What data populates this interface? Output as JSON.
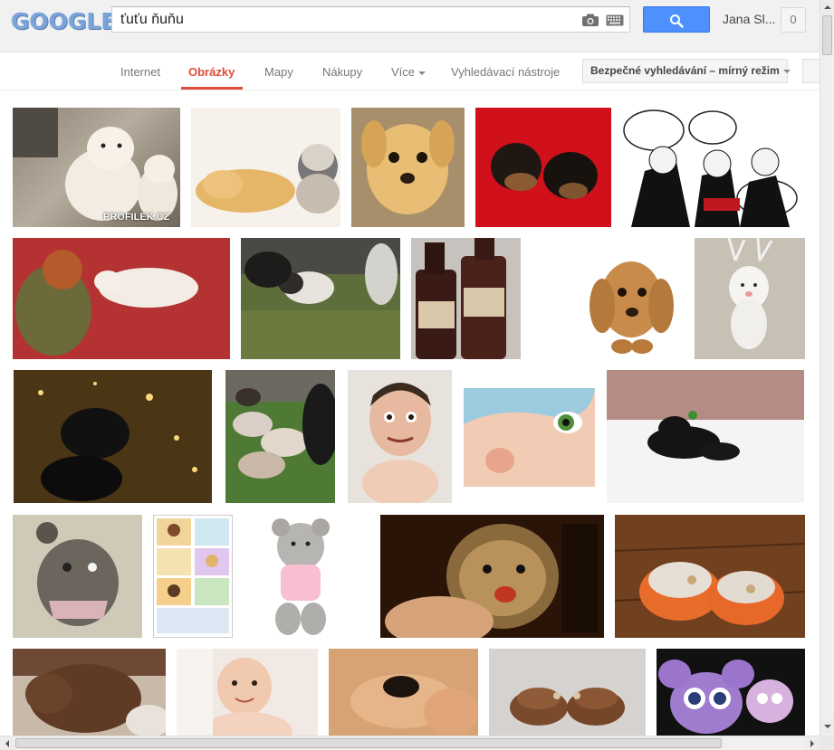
{
  "header": {
    "logo_text": "GOOGLE",
    "search_query": "ťuťu ňuňu",
    "user_name": "Jana Sl...",
    "notification_count": "0",
    "camera_icon": "camera-icon",
    "keyboard_icon": "keyboard-icon",
    "search_icon": "magnifier-icon",
    "brand_blue": "#4d90fe"
  },
  "tabs": {
    "items": [
      "Internet",
      "Obrázky",
      "Mapy",
      "Nákupy",
      "Více",
      "Vyhledávací nástroje"
    ],
    "active": "Obrázky",
    "active_color": "#dd4b39",
    "safesearch_label": "Bezpečné vyhledávání – mírný režim"
  },
  "results": {
    "rows": [
      [
        "two white puppies (PROFILEK.CZ)",
        "puppy sleeping with kitten",
        "golden puppy",
        "two dark puppies on red background",
        "cartoon caricature with speech bubbles"
      ],
      [
        "red-haired girl kissing a dog on red carpet",
        "husky dogs on grass",
        "bottles of Božkov Tuzemák",
        "floppy-eared puppy",
        "white plush figure"
      ],
      [
        "dark silhouette on glittering water",
        "litter of puppies on grass",
        "funny baby with adult face",
        "close-up of child's eye and nose",
        "black puppy lying on bed"
      ],
      [
        "knitted grey toy animal",
        "comic strip",
        "grey teddy bear in pink sweater",
        "hedgehog held in hand",
        "orange knitted baby booties"
      ],
      [
        "sleeping brown puppy",
        "smiling baby",
        "tiny animal in hands",
        "brown knitted booties",
        "purple toy figures"
      ]
    ],
    "watermark": "PROFILEK.CZ"
  }
}
